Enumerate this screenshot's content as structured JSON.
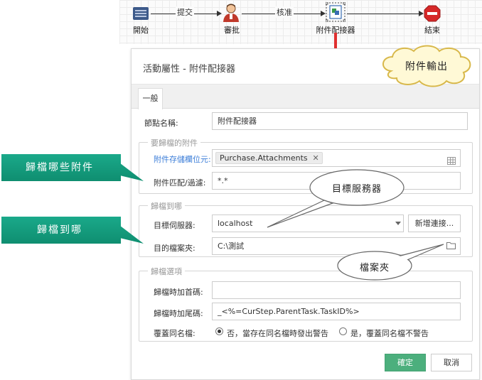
{
  "flow": {
    "nodes": [
      {
        "label": "開始",
        "icon": "start-icon"
      },
      {
        "label": "審批",
        "icon": "person-icon"
      },
      {
        "label": "附件配接器",
        "icon": "adapter-icon"
      },
      {
        "label": "結束",
        "icon": "stop-icon"
      }
    ],
    "edges": [
      "提交",
      "核准"
    ]
  },
  "dialog": {
    "title": "活動屬性 - 附件配接器",
    "tab": "一般",
    "node_name_label": "節點名稱:",
    "node_name_value": "附件配接器",
    "group1": {
      "legend": "要歸檔的附件",
      "storage_field_label": "附件存儲欄位元:",
      "storage_tag": "Purchase.Attachments",
      "match_label": "附件匹配/過濾:",
      "match_value": "*.*"
    },
    "group2": {
      "legend": "歸檔到哪",
      "server_label": "目標伺服器:",
      "server_value": "localhost",
      "new_connection_button": "新增連接...",
      "folder_label": "目的檔案夾:",
      "folder_value": "C:\\測試"
    },
    "group3": {
      "legend": "歸檔選項",
      "prefix_label": "歸檔時加首碼:",
      "prefix_value": "",
      "suffix_label": "歸檔時加尾碼:",
      "suffix_value": "_<%=CurStep.ParentTask.TaskID%>",
      "overwrite_label": "覆蓋同名檔:",
      "option_no": "否，當存在同名檔時發出警告",
      "option_yes": "是，覆蓋同名檔不警告",
      "selected": "no"
    },
    "ok_button": "確定",
    "cancel_button": "取消"
  },
  "callouts": {
    "which_attachments": "歸檔哪些附件",
    "where_to": "歸檔到哪",
    "target_server": "目標服務器",
    "folder": "檔案夾",
    "attachment_output": "附件輸出"
  },
  "colors": {
    "callout_green": "#13a080",
    "primary_button": "#4caf7d",
    "link_blue": "#3b7dd8",
    "red_arrow": "#e03030",
    "bubble_fill": "#ffffff",
    "cloud_fill": "#fff9d6"
  }
}
